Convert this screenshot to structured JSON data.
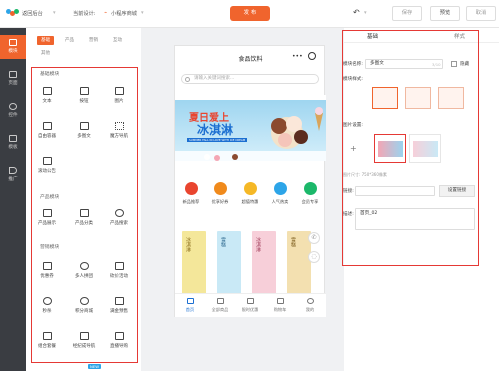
{
  "topbar": {
    "back_label": "返回后台",
    "current_label": "当前设计:",
    "current_name": "小程序商城",
    "publish_label": "发 布",
    "save_label": "保存",
    "preview_label": "预览",
    "cancel_label": "取消"
  },
  "leftnav": {
    "items": [
      {
        "label": "模块",
        "icon": "grid-icon"
      },
      {
        "label": "页面",
        "icon": "page-icon"
      },
      {
        "label": "控件",
        "icon": "widget-icon"
      },
      {
        "label": "模板",
        "icon": "template-icon"
      },
      {
        "label": "推广",
        "icon": "promote-icon"
      }
    ]
  },
  "panel": {
    "tabs": [
      "基础",
      "产品",
      "营销",
      "互动",
      "其他"
    ],
    "sections": [
      {
        "title": "基础模块",
        "items": [
          "文本",
          "按钮",
          "图片",
          "自由容器",
          "多图文",
          "魔方导航",
          "滚动公告"
        ]
      },
      {
        "title": "产品模块",
        "items": [
          "产品展示",
          "产品分类",
          "产品搜索"
        ]
      },
      {
        "title": "营销模块",
        "items": [
          "优惠券",
          "多人拼团",
          "砍价活动",
          "秒杀",
          "积分商城",
          "满金预售",
          "组合套餐",
          "经纪成导航",
          "直播导购"
        ]
      }
    ],
    "badge": "NEW"
  },
  "phone": {
    "title": "食品饮料",
    "search_placeholder": "请输入关键词搜索...",
    "banner_title_1": "夏日爱上",
    "banner_title_2": "冰淇淋",
    "banner_sub": "SUMMER FALL IN LOVE WITH ICE CREAM",
    "categories": [
      {
        "label": "新品推荐",
        "color": "#e9452f"
      },
      {
        "label": "优享好券",
        "color": "#f08a1c"
      },
      {
        "label": "超值特惠",
        "color": "#f5b826"
      },
      {
        "label": "人气热卖",
        "color": "#2da5e8"
      },
      {
        "label": "会员专享",
        "color": "#1cb86a"
      }
    ],
    "products": [
      "冰淇淋",
      "雪糕",
      "冰淇淋",
      "雪糕"
    ],
    "tabbar": [
      "首页",
      "全部商品",
      "限时优惠",
      "购物车",
      "我的"
    ]
  },
  "right": {
    "tabs": [
      "基础",
      "样式"
    ],
    "module_name_label": "模块名称:",
    "module_name_value": "多图文",
    "module_name_counter": "3/10",
    "hide_label": "隐藏",
    "style_label": "模块样式:",
    "image_label": "图片设置:",
    "image_hint": "图片尺寸: 750*360像素",
    "link_label": "链接:",
    "link_button": "设置链接",
    "desc_label": "描述:",
    "desc_value": "首页_02"
  },
  "colors": {
    "accent": "#f0642d",
    "highlight": "#e53935",
    "nav_bg": "#3a3d42"
  }
}
